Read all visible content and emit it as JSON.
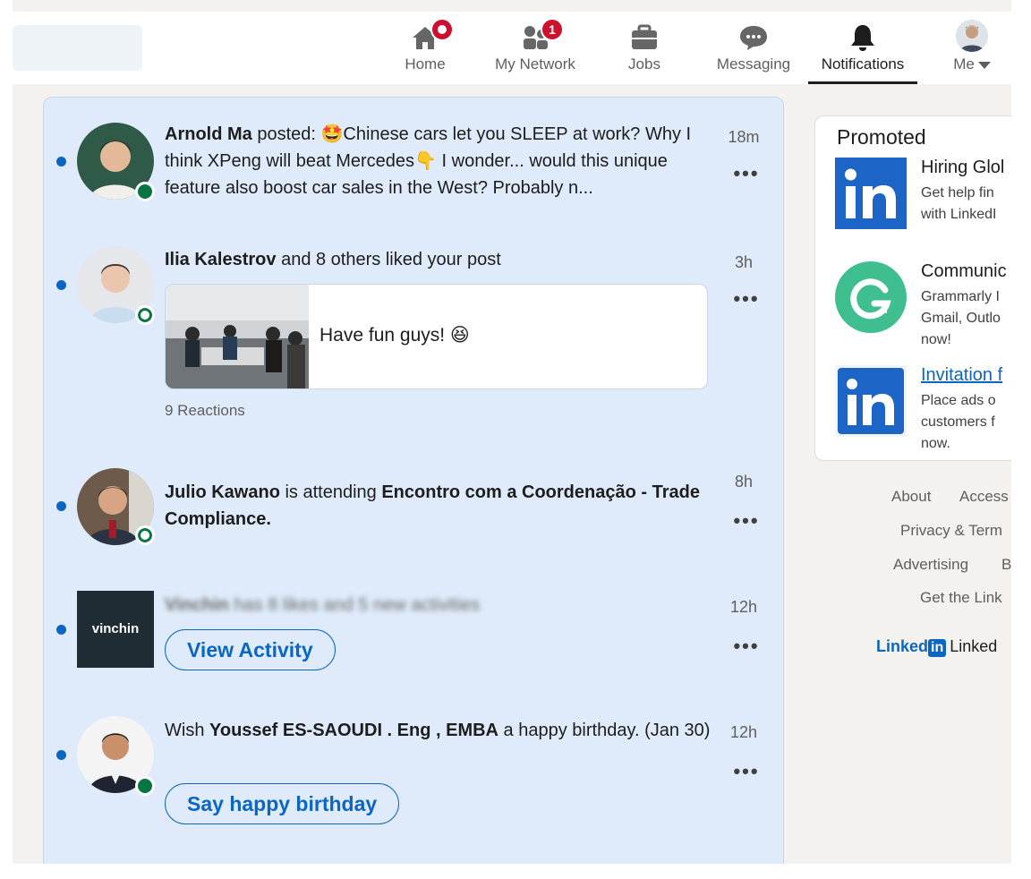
{
  "nav": {
    "items": [
      {
        "label": "Home",
        "icon": "home-icon",
        "badge": "dot"
      },
      {
        "label": "My Network",
        "icon": "network-icon",
        "badge": "1"
      },
      {
        "label": "Jobs",
        "icon": "briefcase-icon"
      },
      {
        "label": "Messaging",
        "icon": "chat-icon"
      },
      {
        "label": "Notifications",
        "icon": "bell-icon",
        "active": true
      },
      {
        "label": "Me",
        "icon": "avatar"
      }
    ],
    "badges": {
      "network": "1"
    }
  },
  "notifications": [
    {
      "actor": "Arnold Ma",
      "action": " posted: ",
      "emoji": "🤩",
      "text": "Chinese cars let you SLEEP at work? Why I think XPeng will beat Mercedes",
      "emoji2": "👇",
      "text2": " I wonder... would this unique feature also boost car sales in the West? Probably n...",
      "time": "18m",
      "more": "•••"
    },
    {
      "actor": "Ilia Kalestrov",
      "action": " and 8 others liked your post",
      "preview_caption": "Have fun guys! 😆",
      "reactions": "9 Reactions",
      "time": "3h",
      "more": "•••"
    },
    {
      "actor": "Julio Kawano",
      "action": " is attending ",
      "event": "Encontro com a Coordenação - Trade Compliance.",
      "time": "8h",
      "more": "•••"
    },
    {
      "actor": "Vinchin",
      "action": " has 8 likes and 5 new activities",
      "logo_text": "vinchin",
      "button": "View Activity",
      "time": "12h",
      "more": "•••"
    },
    {
      "prefix": "Wish ",
      "actor": "Youssef ES-SAOUDI . Eng , EMBA",
      "action": " a happy birthday. (Jan 30)",
      "button": "Say happy birthday",
      "time": "12h",
      "more": "•••"
    }
  ],
  "promoted": {
    "title": "Promoted",
    "items": [
      {
        "headline": "Hiring Glol",
        "body": [
          "Get help fin",
          "with LinkedI"
        ],
        "logo": "linkedin-logo"
      },
      {
        "headline": "Communic",
        "body": [
          "Grammarly I",
          "Gmail, Outlo",
          "now!"
        ],
        "logo": "grammarly-logo"
      },
      {
        "headline": "Invitation f",
        "body": [
          "Place ads o",
          "customers f",
          "now."
        ],
        "logo": "linkedin-logo"
      }
    ]
  },
  "footer": {
    "links": [
      "About",
      "Access",
      "Privacy & Term",
      "Advertising",
      "B",
      "Get the Link"
    ],
    "brand_wordmark": "Linked",
    "brand_in": "in",
    "brand_text": "Linked"
  },
  "colors": {
    "accent": "#0a66c2",
    "badge": "#cb112d",
    "online": "#057642",
    "unread_bg": "#dfebfa"
  }
}
